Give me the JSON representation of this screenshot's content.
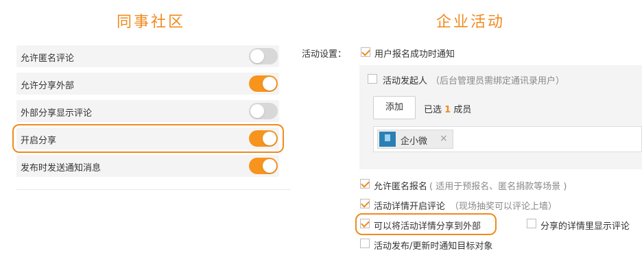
{
  "left": {
    "title": "同事社区",
    "rows": [
      {
        "label": "允许匿名评论",
        "enabled": false
      },
      {
        "label": "允许分享外部",
        "enabled": true
      },
      {
        "label": "外部分享显示评论",
        "enabled": false
      },
      {
        "label": "开启分享",
        "enabled": true
      },
      {
        "label": "发布时发送通知消息",
        "enabled": true
      }
    ]
  },
  "right": {
    "title": "企业活动",
    "settings_label": "活动设置：",
    "options": {
      "signup_notify": {
        "label": "用户报名成功时通知",
        "checked": true
      },
      "organizer": {
        "label": "活动发起人",
        "hint": "（后台管理员需绑定通讯录用户）",
        "checked": false
      },
      "add_button": "添加",
      "selected_prefix": "已选",
      "selected_count": "1",
      "selected_suffix": "成员",
      "selected_member": "企小微",
      "remove_icon": "×",
      "anonymous_signup": {
        "label": "允许匿名报名",
        "hint": "( 适用于预报名、匿名捐款等场景 )",
        "checked": true
      },
      "detail_comments": {
        "label": "活动详情开启评论",
        "hint": "（现场抽奖可以评论上墙）",
        "checked": true
      },
      "share_external": {
        "label": "可以将活动详情分享到外部",
        "checked": true
      },
      "share_show_comments": {
        "label": "分享的详情里显示评论",
        "checked": false
      },
      "publish_notify": {
        "label": "活动发布/更新时通知目标对象",
        "checked": false
      }
    }
  },
  "colors": {
    "accent": "#f08a1c",
    "toggle_on": "#f7941d",
    "toggle_off": "#d8d8d8",
    "row_bg": "#f4f4f4"
  }
}
